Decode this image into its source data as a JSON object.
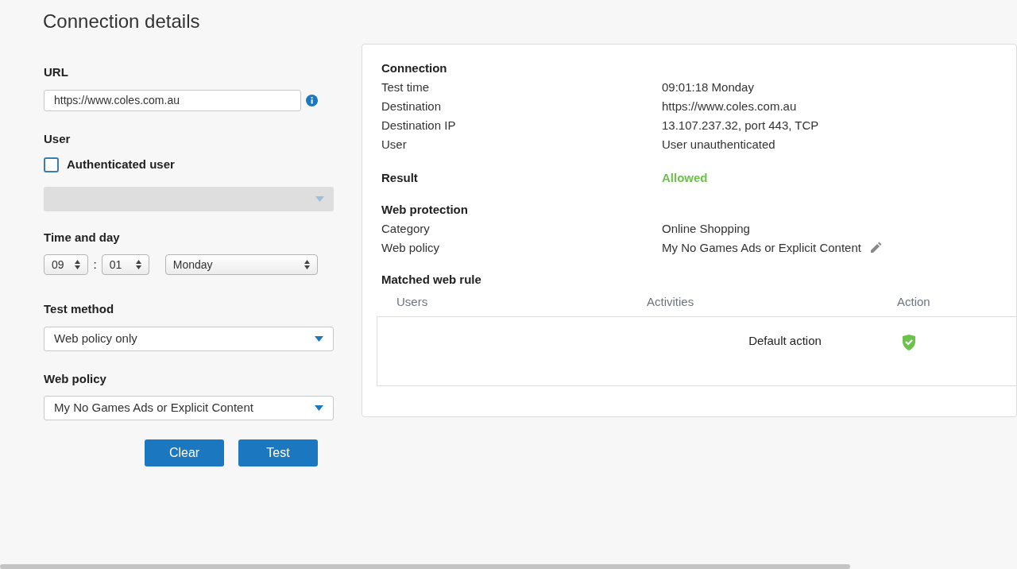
{
  "title": "Connection details",
  "form": {
    "url": {
      "label": "URL",
      "value": "https://www.coles.com.au"
    },
    "user": {
      "label": "User",
      "checkbox_label": "Authenticated user",
      "checked": false,
      "select_disabled": true
    },
    "time": {
      "label": "Time and day",
      "hour": "09",
      "separator": ":",
      "minute": "01",
      "day": "Monday"
    },
    "test_method": {
      "label": "Test method",
      "value": "Web policy only"
    },
    "web_policy": {
      "label": "Web policy",
      "value": "My No Games Ads or Explicit Content"
    },
    "buttons": [
      "Clear",
      "Test"
    ]
  },
  "details": {
    "connection": {
      "heading": "Connection",
      "rows": [
        {
          "label": "Test time",
          "value": "09:01:18 Monday"
        },
        {
          "label": "Destination",
          "value": "https://www.coles.com.au"
        },
        {
          "label": "Destination IP",
          "value": "13.107.237.32, port 443, TCP"
        },
        {
          "label": "User",
          "value": "User unauthenticated"
        }
      ]
    },
    "result": {
      "label": "Result",
      "value": "Allowed",
      "kind": "allowed"
    },
    "web_protection": {
      "heading": "Web protection",
      "rows": [
        {
          "label": "Category",
          "value": "Online Shopping",
          "editable": false
        },
        {
          "label": "Web policy",
          "value": "My No Games Ads or Explicit Content",
          "editable": true
        }
      ]
    },
    "matched_rule": {
      "heading": "Matched web rule",
      "columns": [
        "Users",
        "Activities",
        "Action"
      ],
      "rows": [
        {
          "activities": "Default action",
          "kind": "allow"
        }
      ]
    }
  }
}
